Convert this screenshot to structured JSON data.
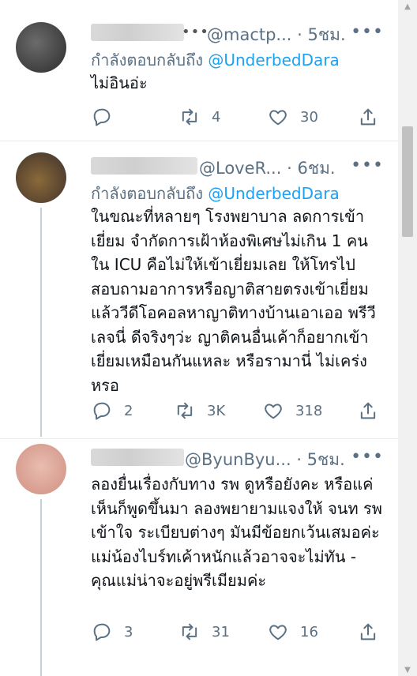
{
  "tweets": [
    {
      "handle": "@mactp...",
      "time": "5ชม.",
      "replying_prefix": "กำลังตอบกลับถึง",
      "replying_to": "@UnderbedDara",
      "text": "ไม่อินอ่ะ",
      "stats": {
        "replies": "",
        "retweets": "4",
        "likes": "30"
      }
    },
    {
      "handle": "@LoveR...",
      "time": "6ชม.",
      "replying_prefix": "กำลังตอบกลับถึง",
      "replying_to": "@UnderbedDara",
      "text": "ในขณะที่หลายๆ โรงพยาบาล ลดการเข้าเยี่ยม จำกัดการเฝ้าห้องพิเศษไม่เกิน 1 คน ใน ICU คือไม่ให้เข้าเยี่ยมเลย ให้โทรไปสอบถามอาการหรือญาติสายตรงเข้าเยี่ยมแล้ววีดีโอคอลหาญาติทางบ้านเอาเออ พรีวีเลจนี่ ดีจริงๆว่ะ ญาติคนอื่นเค้าก็อยากเข้าเยี่ยมเหมือนกันแหละ หรือรามานี่ ไม่เคร่งหรอ",
      "stats": {
        "replies": "2",
        "retweets": "3K",
        "likes": "318"
      }
    },
    {
      "handle": "@ByunByu...",
      "time": "5ชม.",
      "text": "ลองยื่นเรื่องกับทาง รพ ดูหรือยังคะ หรือแค่เห็นก็พูดขึ้นมา ลองพยายามแจงให้ จนท รพ เข้าใจ ระเบียบต่างๆ มันมีข้อยกเว้นเสมอค่ะ แม่น้องไบร์ทเค้าหนักแล้วอาจจะไม่ทัน - คุณแม่น่าจะอยู่พรีเมียมค่ะ",
      "stats": {
        "replies": "3",
        "retweets": "31",
        "likes": "16"
      }
    }
  ],
  "colors": {
    "accent": "#1da1f2",
    "muted": "#5b7083",
    "text": "#0f1419"
  },
  "icons": {
    "reply": "reply-icon",
    "retweet": "retweet-icon",
    "like": "like-icon",
    "share": "share-icon",
    "more": "more-icon"
  }
}
